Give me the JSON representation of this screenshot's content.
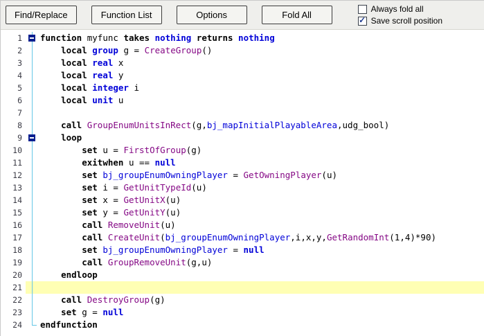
{
  "toolbar": {
    "buttons": [
      "Find/Replace",
      "Function List",
      "Options",
      "Fold All"
    ],
    "checkboxes": [
      {
        "label": "Always fold all",
        "checked": false
      },
      {
        "label": "Save scroll position",
        "checked": true
      }
    ]
  },
  "colors": {
    "keyword": "#000000",
    "type": "#0000d8",
    "native": "#850885",
    "variable": "#0000d8",
    "line_highlight": "#ffffb4",
    "fold_line": "#63c6e6",
    "fold_box": "#0a1f8f"
  },
  "editor": {
    "highlighted_line": 21,
    "fold_marker_lines": [
      1,
      9
    ],
    "lines": [
      {
        "n": "1",
        "fold": "box",
        "tokens": [
          [
            "k",
            "function"
          ],
          [
            "p",
            " myfunc "
          ],
          [
            "k",
            "takes"
          ],
          [
            "p",
            " "
          ],
          [
            "t",
            "nothing"
          ],
          [
            "p",
            " "
          ],
          [
            "k",
            "returns"
          ],
          [
            "p",
            " "
          ],
          [
            "t",
            "nothing"
          ]
        ]
      },
      {
        "n": "2",
        "fold": "line",
        "tokens": [
          [
            "p",
            "    "
          ],
          [
            "k",
            "local"
          ],
          [
            "p",
            " "
          ],
          [
            "t",
            "group"
          ],
          [
            "p",
            " g = "
          ],
          [
            "n",
            "CreateGroup"
          ],
          [
            "p",
            "()"
          ]
        ]
      },
      {
        "n": "3",
        "fold": "line",
        "tokens": [
          [
            "p",
            "    "
          ],
          [
            "k",
            "local"
          ],
          [
            "p",
            " "
          ],
          [
            "t",
            "real"
          ],
          [
            "p",
            " x"
          ]
        ]
      },
      {
        "n": "4",
        "fold": "line",
        "tokens": [
          [
            "p",
            "    "
          ],
          [
            "k",
            "local"
          ],
          [
            "p",
            " "
          ],
          [
            "t",
            "real"
          ],
          [
            "p",
            " y"
          ]
        ]
      },
      {
        "n": "5",
        "fold": "line",
        "tokens": [
          [
            "p",
            "    "
          ],
          [
            "k",
            "local"
          ],
          [
            "p",
            " "
          ],
          [
            "t",
            "integer"
          ],
          [
            "p",
            " i"
          ]
        ]
      },
      {
        "n": "6",
        "fold": "line",
        "tokens": [
          [
            "p",
            "    "
          ],
          [
            "k",
            "local"
          ],
          [
            "p",
            " "
          ],
          [
            "t",
            "unit"
          ],
          [
            "p",
            " u"
          ]
        ]
      },
      {
        "n": "7",
        "fold": "line",
        "tokens": []
      },
      {
        "n": "8",
        "fold": "line",
        "tokens": [
          [
            "p",
            "    "
          ],
          [
            "k",
            "call"
          ],
          [
            "p",
            " "
          ],
          [
            "n",
            "GroupEnumUnitsInRect"
          ],
          [
            "p",
            "(g,"
          ],
          [
            "v",
            "bj_mapInitialPlayableArea"
          ],
          [
            "p",
            ",udg_bool)"
          ]
        ]
      },
      {
        "n": "9",
        "fold": "box",
        "tokens": [
          [
            "p",
            "    "
          ],
          [
            "k",
            "loop"
          ]
        ]
      },
      {
        "n": "10",
        "fold": "line",
        "tokens": [
          [
            "p",
            "        "
          ],
          [
            "k",
            "set"
          ],
          [
            "p",
            " u = "
          ],
          [
            "n",
            "FirstOfGroup"
          ],
          [
            "p",
            "(g)"
          ]
        ]
      },
      {
        "n": "11",
        "fold": "line",
        "tokens": [
          [
            "p",
            "        "
          ],
          [
            "k",
            "exitwhen"
          ],
          [
            "p",
            " u == "
          ],
          [
            "t",
            "null"
          ]
        ]
      },
      {
        "n": "12",
        "fold": "line",
        "tokens": [
          [
            "p",
            "        "
          ],
          [
            "k",
            "set"
          ],
          [
            "p",
            " "
          ],
          [
            "v",
            "bj_groupEnumOwningPlayer"
          ],
          [
            "p",
            " = "
          ],
          [
            "n",
            "GetOwningPlayer"
          ],
          [
            "p",
            "(u)"
          ]
        ]
      },
      {
        "n": "13",
        "fold": "line",
        "tokens": [
          [
            "p",
            "        "
          ],
          [
            "k",
            "set"
          ],
          [
            "p",
            " i = "
          ],
          [
            "n",
            "GetUnitTypeId"
          ],
          [
            "p",
            "(u)"
          ]
        ]
      },
      {
        "n": "14",
        "fold": "line",
        "tokens": [
          [
            "p",
            "        "
          ],
          [
            "k",
            "set"
          ],
          [
            "p",
            " x = "
          ],
          [
            "n",
            "GetUnitX"
          ],
          [
            "p",
            "(u)"
          ]
        ]
      },
      {
        "n": "15",
        "fold": "line",
        "tokens": [
          [
            "p",
            "        "
          ],
          [
            "k",
            "set"
          ],
          [
            "p",
            " y = "
          ],
          [
            "n",
            "GetUnitY"
          ],
          [
            "p",
            "(u)"
          ]
        ]
      },
      {
        "n": "16",
        "fold": "line",
        "tokens": [
          [
            "p",
            "        "
          ],
          [
            "k",
            "call"
          ],
          [
            "p",
            " "
          ],
          [
            "n",
            "RemoveUnit"
          ],
          [
            "p",
            "(u)"
          ]
        ]
      },
      {
        "n": "17",
        "fold": "line",
        "tokens": [
          [
            "p",
            "        "
          ],
          [
            "k",
            "call"
          ],
          [
            "p",
            " "
          ],
          [
            "n",
            "CreateUnit"
          ],
          [
            "p",
            "("
          ],
          [
            "v",
            "bj_groupEnumOwningPlayer"
          ],
          [
            "p",
            ",i,x,y,"
          ],
          [
            "n",
            "GetRandomInt"
          ],
          [
            "p",
            "(1,4)*90)"
          ]
        ]
      },
      {
        "n": "18",
        "fold": "line",
        "tokens": [
          [
            "p",
            "        "
          ],
          [
            "k",
            "set"
          ],
          [
            "p",
            " "
          ],
          [
            "v",
            "bj_groupEnumOwningPlayer"
          ],
          [
            "p",
            " = "
          ],
          [
            "t",
            "null"
          ]
        ]
      },
      {
        "n": "19",
        "fold": "line",
        "tokens": [
          [
            "p",
            "        "
          ],
          [
            "k",
            "call"
          ],
          [
            "p",
            " "
          ],
          [
            "n",
            "GroupRemoveUnit"
          ],
          [
            "p",
            "(g,u)"
          ]
        ]
      },
      {
        "n": "20",
        "fold": "line",
        "tokens": [
          [
            "p",
            "    "
          ],
          [
            "k",
            "endloop"
          ]
        ]
      },
      {
        "n": "21",
        "fold": "line",
        "hl": true,
        "tokens": []
      },
      {
        "n": "22",
        "fold": "line",
        "tokens": [
          [
            "p",
            "    "
          ],
          [
            "k",
            "call"
          ],
          [
            "p",
            " "
          ],
          [
            "n",
            "DestroyGroup"
          ],
          [
            "p",
            "(g)"
          ]
        ]
      },
      {
        "n": "23",
        "fold": "line",
        "tokens": [
          [
            "p",
            "    "
          ],
          [
            "k",
            "set"
          ],
          [
            "p",
            " g = "
          ],
          [
            "t",
            "null"
          ]
        ]
      },
      {
        "n": "24",
        "fold": "end",
        "tokens": [
          [
            "k",
            "endfunction"
          ]
        ]
      }
    ]
  }
}
